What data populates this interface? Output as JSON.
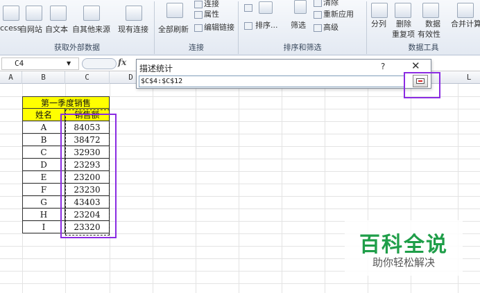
{
  "ribbon": {
    "get_external": {
      "access_label": "ccess",
      "web_label": "自网站",
      "text_label": "自文本",
      "other_label": "自其他来源",
      "existing_label": "现有连接",
      "group_label": "获取外部数据"
    },
    "connections": {
      "refresh_all_label": "全部刷新",
      "connection_label": "连接",
      "properties_label": "属性",
      "edit_links_label": "编辑链接",
      "group_label": "连接"
    },
    "sort_filter": {
      "sort_label": "排序...",
      "filter_label": "筛选",
      "clear_label": "清除",
      "reapply_label": "重新应用",
      "advanced_label": "高级",
      "group_label": "排序和筛选"
    },
    "data_tools": {
      "text_to_columns_label": "分列",
      "remove_dup_label": "删除",
      "remove_dup_label2": "重复项",
      "validation_label": "数据",
      "validation_label2": "有效性",
      "consolidate_label": "合并计算",
      "group_label": "数据工具"
    }
  },
  "formula_bar": {
    "name_box": "C4",
    "fx": "fx"
  },
  "columns": [
    "A",
    "B",
    "C",
    "D",
    "L"
  ],
  "table": {
    "title": "第一季度销售",
    "header_name": "姓名",
    "header_sales": "销售额",
    "rows": [
      {
        "name": "A",
        "sales": "84053"
      },
      {
        "name": "B",
        "sales": "38472"
      },
      {
        "name": "C",
        "sales": "32930"
      },
      {
        "name": "D",
        "sales": "23293"
      },
      {
        "name": "E",
        "sales": "23200"
      },
      {
        "name": "F",
        "sales": "23230"
      },
      {
        "name": "G",
        "sales": "43403"
      },
      {
        "name": "H",
        "sales": "23204"
      },
      {
        "name": "I",
        "sales": "23320"
      }
    ]
  },
  "dialog": {
    "title": "描述统计",
    "help": "?",
    "close": "✕",
    "range_value": "$C$4:$C$12"
  },
  "watermark": {
    "title": "百科全说",
    "subtitle": "助你轻松解决"
  },
  "colors": {
    "highlight": "#8a2be2",
    "table_yellow": "#ffff00",
    "watermark_green": "#1f9e49"
  }
}
